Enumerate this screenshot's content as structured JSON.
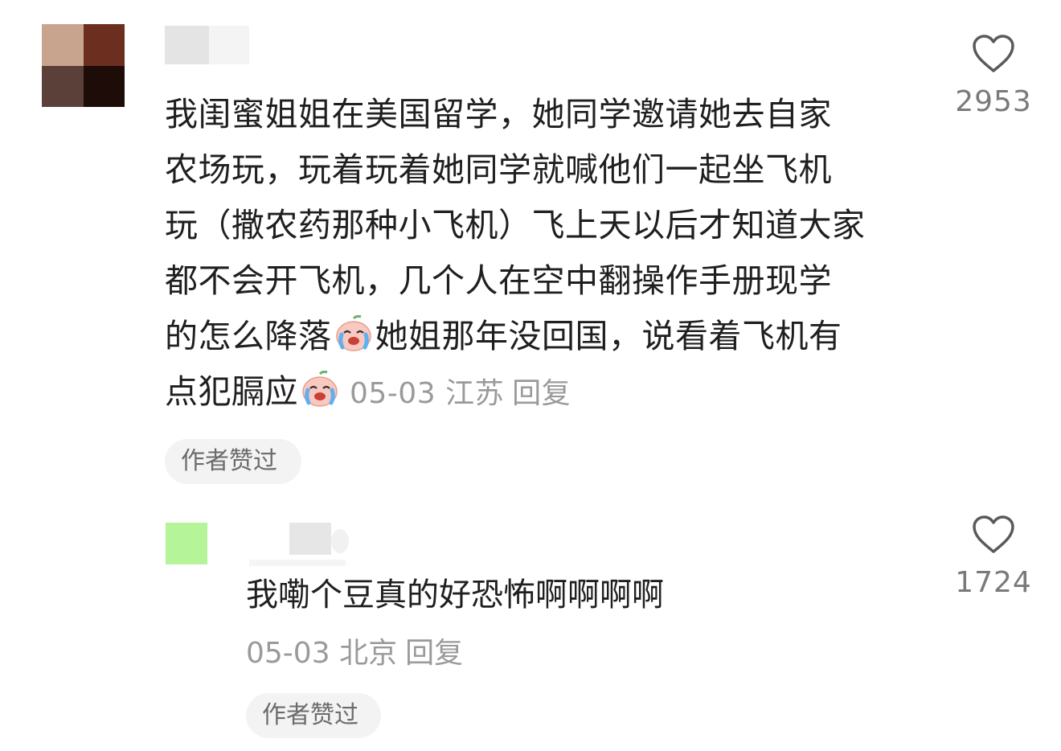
{
  "comment": {
    "lines": [
      "我闺蜜姐姐在美国留学，她同学邀请她去自家",
      "农场玩，玩着玩着她同学就喊他们一起坐飞机",
      "玩（撒农药那种小飞机）飞上天以后才知道大家",
      "都不会开飞机，几个人在空中翻操作手册现学",
      "的怎么降落",
      "她姐那年没回国，说看着飞机有",
      "点犯膈应"
    ],
    "emoji_icon": "crying-face-emoji",
    "date": "05-03",
    "location": "江苏",
    "reply_label": "回复",
    "author_liked": "作者赞过",
    "like_count": "2953"
  },
  "reply": {
    "text": "我嘞个豆真的好恐怖啊啊啊啊",
    "date": "05-03",
    "location": "北京",
    "reply_label": "回复",
    "author_liked": "作者赞过",
    "like_count": "1724"
  },
  "icons": {
    "like": "heart-outline-icon"
  },
  "colors": {
    "text": "#1f1f1f",
    "meta": "#9a9a9a",
    "badge_bg": "#f3f3f3"
  }
}
